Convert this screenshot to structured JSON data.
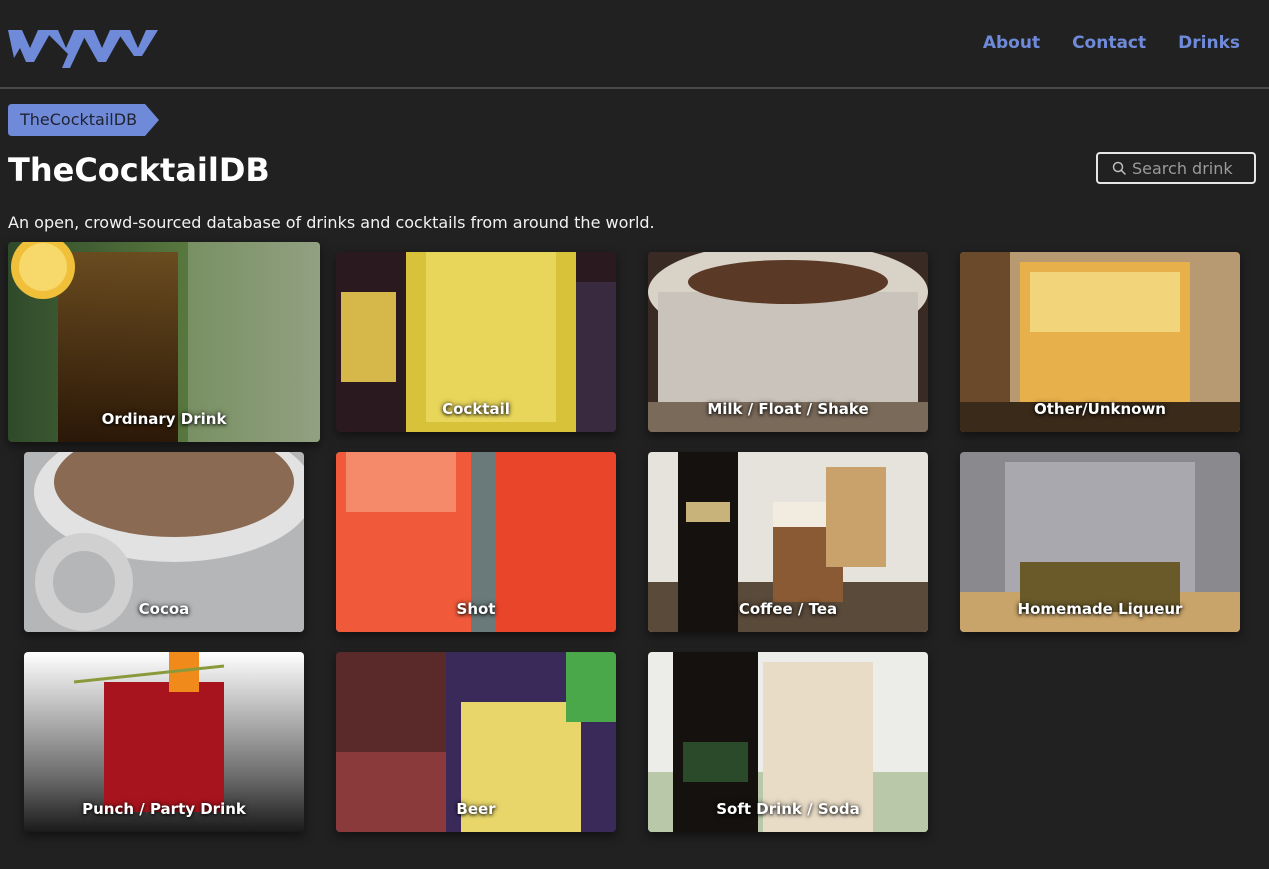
{
  "nav": {
    "about": "About",
    "contact": "Contact",
    "drinks": "Drinks"
  },
  "breadcrumb": "TheCocktailDB",
  "title": "TheCocktailDB",
  "subtitle": "An open, crowd-sourced database of drinks and cocktails from around the world.",
  "search": {
    "placeholder": "Search drink"
  },
  "categories": [
    "Ordinary Drink",
    "Cocktail",
    "Milk / Float / Shake",
    "Other/Unknown",
    "Cocoa",
    "Shot",
    "Coffee / Tea",
    "Homemade Liqueur",
    "Punch / Party Drink",
    "Beer",
    "Soft Drink / Soda"
  ],
  "colors": {
    "background": "#212121",
    "accent": "#6f8ad9"
  }
}
